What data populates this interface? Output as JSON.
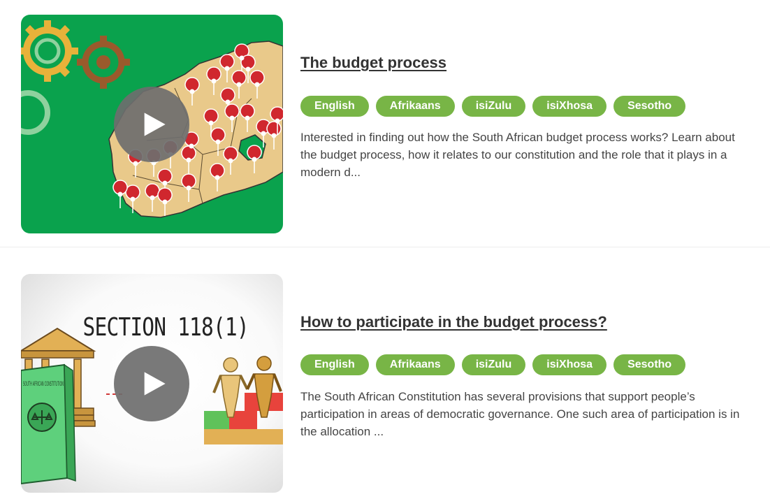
{
  "videos": [
    {
      "title": "The budget process",
      "languages": [
        "English",
        "Afrikaans",
        "isiZulu",
        "isiXhosa",
        "Sesotho"
      ],
      "description": "Interested in finding out how the South African budget process works? Learn about the budget process, how it relates to our constitution and the role that it plays in a modern d...",
      "thumbnail_icon": "south-africa-map-with-pins",
      "thumbnail_background": "#0aa24d"
    },
    {
      "title": "How to participate in the budget process?",
      "languages": [
        "English",
        "Afrikaans",
        "isiZulu",
        "isiXhosa",
        "Sesotho"
      ],
      "description": "The South African Constitution has several provisions that support people’s participation in areas of democratic governance. One such area of participation is in the allocation ...",
      "thumbnail_icon": "constitution-and-people-illustration",
      "thumbnail_text": "SECTION 118(1)",
      "thumbnail_book_text": "SOUTH AFRICAN CONSTITUTION"
    }
  ],
  "colors": {
    "tag_background": "#78b546",
    "tag_text": "#ffffff",
    "title": "#333333",
    "body_text": "#444444"
  },
  "play_icon": "play-icon"
}
